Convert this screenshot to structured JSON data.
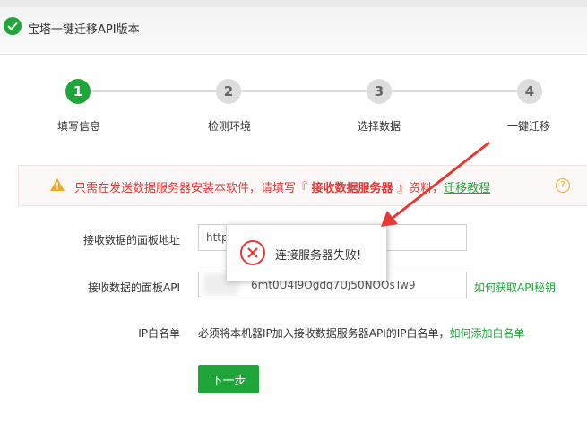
{
  "window": {
    "title": "宝塔一键迁移API版本"
  },
  "steps": [
    {
      "num": "1",
      "label": "填写信息"
    },
    {
      "num": "2",
      "label": "检测环境"
    },
    {
      "num": "3",
      "label": "选择数据"
    },
    {
      "num": "4",
      "label": "一键迁移"
    }
  ],
  "warning": {
    "prefix": "只需在发送数据服务器安装本软件，请填写『",
    "bold": " 接收数据服务器 ",
    "suffix": "』资料，",
    "link": "迁移教程",
    "help": "?"
  },
  "form": {
    "panel_url": {
      "label": "接收数据的面板地址",
      "value": "http"
    },
    "panel_api": {
      "label": "接收数据的面板API",
      "value": "6mt0U4I9Ogdq7Uj50NOOsTw9",
      "link": "如何获取API秘钥"
    },
    "whitelist": {
      "label": "IP白名单",
      "note": "必须将本机器IP加入接收数据服务器API的IP白名单，",
      "link": "如何添加白名单"
    }
  },
  "buttons": {
    "next": "下一步"
  },
  "toast": {
    "message": "连接服务器失败!"
  },
  "colors": {
    "accent": "#20a53a",
    "warning": "#e53935",
    "error": "#e53935",
    "annotation_arrow": "#e53935"
  }
}
